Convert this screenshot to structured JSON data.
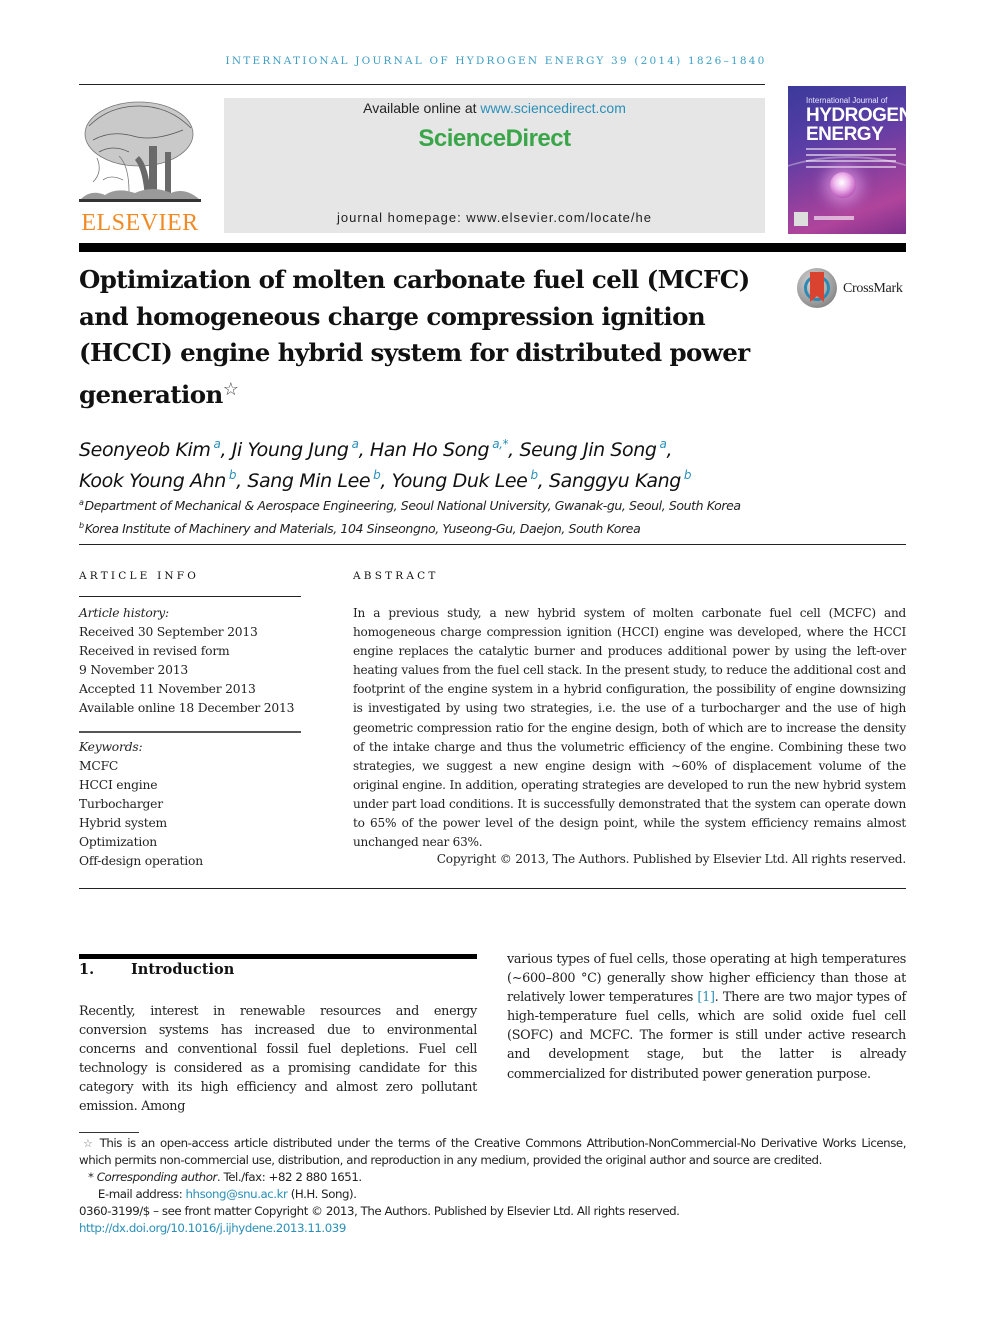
{
  "running_head": "INTERNATIONAL JOURNAL OF HYDROGEN ENERGY 39 (2014) 1826–1840",
  "publisher": {
    "logo_text": "ELSEVIER",
    "brand_color": "#f08a24"
  },
  "sciencedirect_box": {
    "available_prefix": "Available online at ",
    "available_link": "www.sciencedirect.com",
    "brand_name": "ScienceDirect",
    "brand_color": "#3aa64a",
    "homepage": "journal homepage: www.elsevier.com/locate/he"
  },
  "journal_cover": {
    "line1": "International Journal of",
    "line2": "HYDROGEN",
    "line3": "ENERGY"
  },
  "crossmark": {
    "label": "CrossMark"
  },
  "article": {
    "title": "Optimization of molten carbonate fuel cell (MCFC) and homogeneous charge compression ignition (HCCI) engine hybrid system for distributed power generation",
    "title_footnote_mark": "☆",
    "authors": [
      {
        "name": "Seonyeob Kim",
        "aff": "a",
        "sep": ", "
      },
      {
        "name": "Ji Young Jung",
        "aff": "a",
        "sep": ", "
      },
      {
        "name": "Han Ho Song",
        "aff": "a,*",
        "sep": ", "
      },
      {
        "name": "Seung Jin Song",
        "aff": "a",
        "sep": ","
      },
      {
        "name": "Kook Young Ahn",
        "aff": "b",
        "sep": ", "
      },
      {
        "name": "Sang Min Lee",
        "aff": "b",
        "sep": ", "
      },
      {
        "name": "Young Duk Lee",
        "aff": "b",
        "sep": ", "
      },
      {
        "name": "Sanggyu Kang",
        "aff": "b",
        "sep": ""
      }
    ],
    "affiliations": [
      {
        "mark": "a",
        "text": "Department of Mechanical & Aerospace Engineering, Seoul National University, Gwanak-gu, Seoul, South Korea"
      },
      {
        "mark": "b",
        "text": "Korea Institute of Machinery and Materials, 104 Sinseongno, Yuseong-Gu, Daejon, South Korea"
      }
    ]
  },
  "article_info": {
    "section_label": "ARTICLE INFO",
    "history_label": "Article history:",
    "history": [
      "Received 30 September 2013",
      "Received in revised form",
      "9 November 2013",
      "Accepted 11 November 2013",
      "Available online 18 December 2013"
    ],
    "keywords_label": "Keywords:",
    "keywords": [
      "MCFC",
      "HCCI engine",
      "Turbocharger",
      "Hybrid system",
      "Optimization",
      "Off-design operation"
    ]
  },
  "abstract": {
    "section_label": "ABSTRACT",
    "text": "In a previous study, a new hybrid system of molten carbonate fuel cell (MCFC) and homogeneous charge compression ignition (HCCI) engine was developed, where the HCCI engine replaces the catalytic burner and produces additional power by using the left-over heating values from the fuel cell stack. In the present study, to reduce the additional cost and footprint of the engine system in a hybrid configuration, the possibility of engine downsizing is investigated by using two strategies, i.e. the use of a turbocharger and the use of high geometric compression ratio for the engine design, both of which are to increase the density of the intake charge and thus the volumetric efficiency of the engine. Combining these two strategies, we suggest a new engine design with ∼60% of displacement volume of the original engine. In addition, operating strategies are developed to run the new hybrid system under part load conditions. It is successfully demonstrated that the system can operate down to 65% of the power level of the design point, while the system efficiency remains almost unchanged near 63%.",
    "copyright": "Copyright © 2013, The Authors. Published by Elsevier Ltd. All rights reserved."
  },
  "introduction": {
    "number": "1.",
    "heading": "Introduction",
    "left_text": "Recently, interest in renewable resources and energy conversion systems has increased due to environmental concerns and conventional fossil fuel depletions. Fuel cell technology is considered as a promising candidate for this category with its high efficiency and almost zero pollutant emission. Among",
    "right_text_before_ref": "various types of fuel cells, those operating at high temperatures (∼600–800 °C) generally show higher efficiency than those at relatively lower temperatures ",
    "right_ref": "[1]",
    "right_text_after_ref": ". There are two major types of high-temperature fuel cells, which are solid oxide fuel cell (SOFC) and MCFC. The former is still under active research and development stage, but the latter is already commercialized for distributed power generation purpose."
  },
  "footnotes": {
    "license_mark": "☆",
    "license": "This is an open-access article distributed under the terms of the Creative Commons Attribution-NonCommercial-No Derivative Works License, which permits non-commercial use, distribution, and reproduction in any medium, provided the original author and source are credited.",
    "corresponding_mark": "*",
    "corresponding_label": "Corresponding author",
    "corresponding_phone": ". Tel./fax: +82 2 880 1651.",
    "email_label": "E-mail address: ",
    "email": "hhsong@snu.ac.kr",
    "email_suffix": " (H.H. Song).",
    "issn_line": "0360-3199/$ – see front matter Copyright © 2013, The Authors. Published by Elsevier Ltd. All rights reserved.",
    "doi": "http://dx.doi.org/10.1016/j.ijhydene.2013.11.039"
  },
  "colors": {
    "link": "#2a8fb8",
    "running_head": "#3c9ec4"
  }
}
